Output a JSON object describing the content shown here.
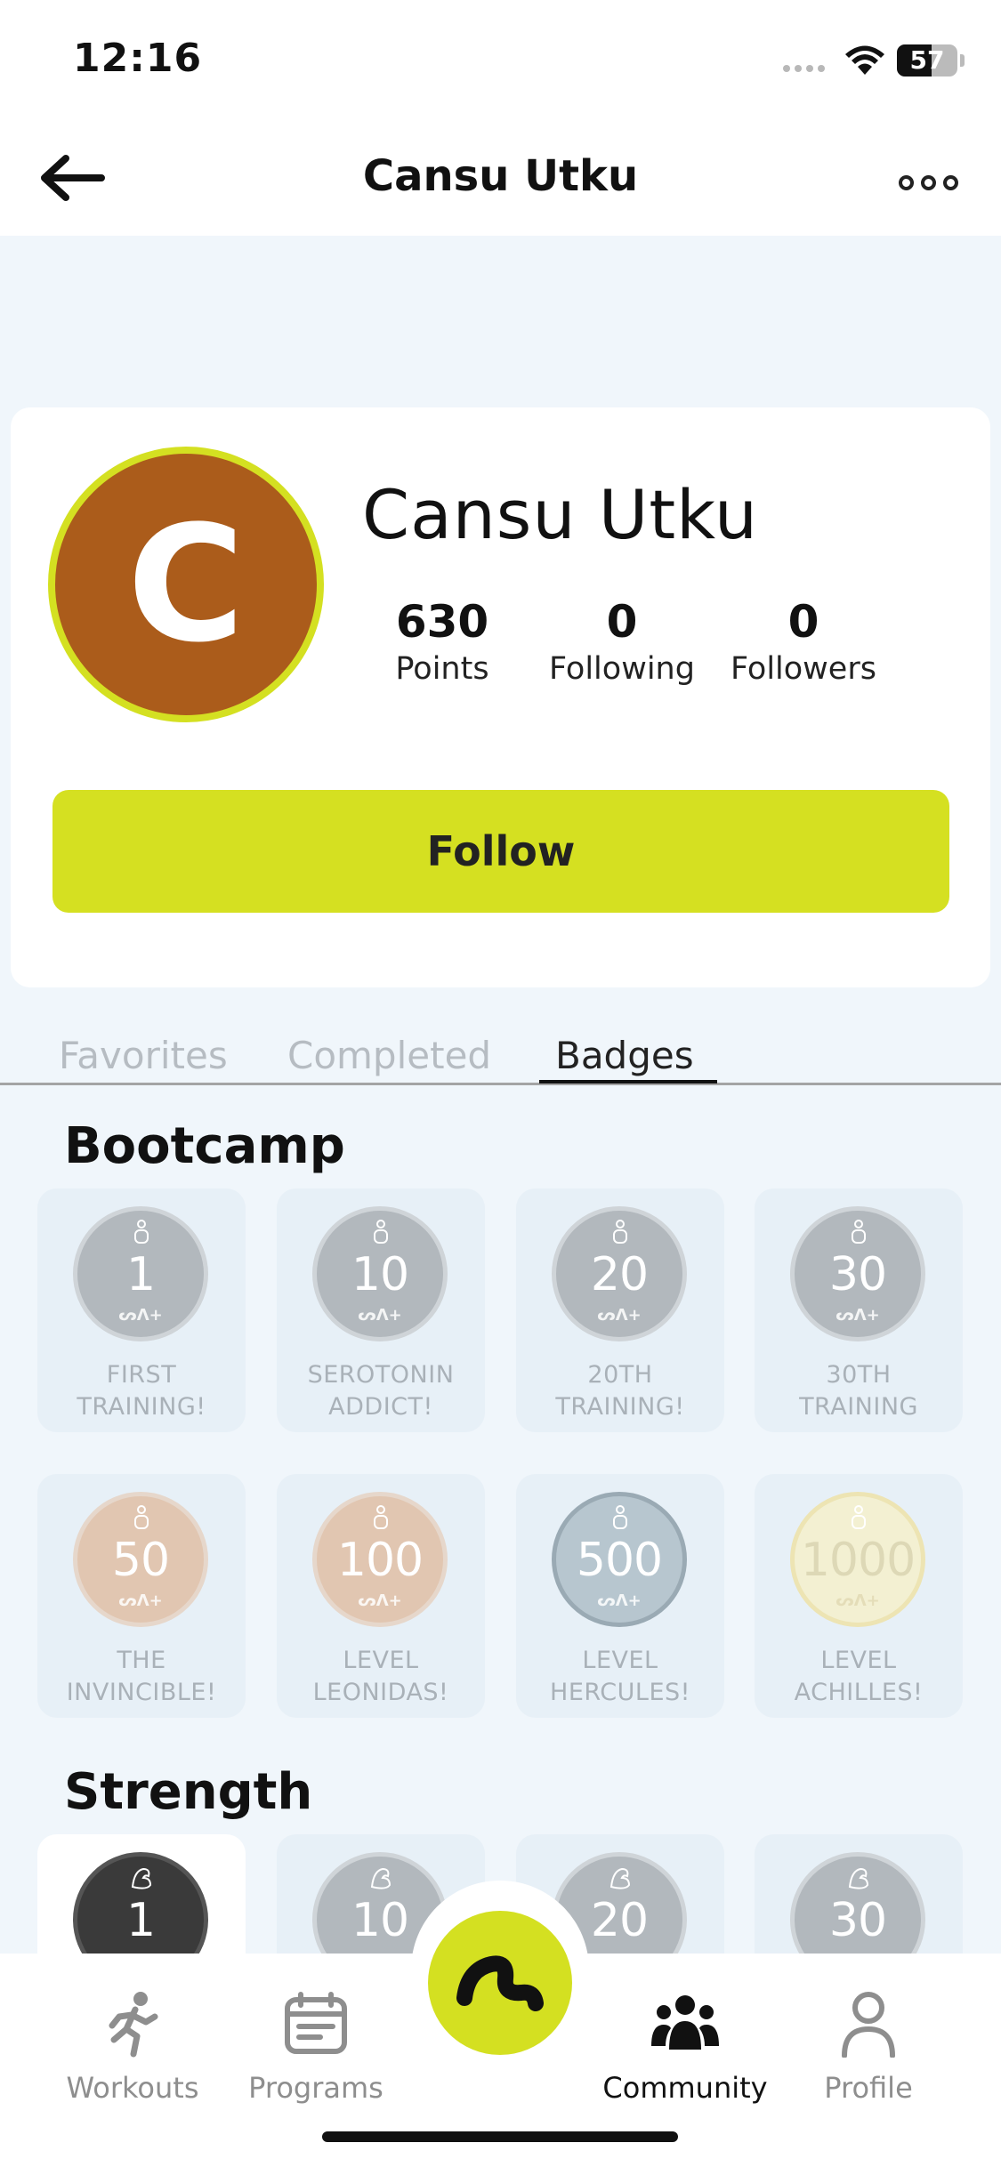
{
  "status": {
    "time": "12:16",
    "battery": "57",
    "battery_level": 0.57
  },
  "header": {
    "title": "Cansu Utku"
  },
  "profile": {
    "initial": "C",
    "name": "Cansu Utku",
    "avatar_color": "#ab5c1b",
    "stats": [
      {
        "value": "630",
        "label": "Points"
      },
      {
        "value": "0",
        "label": "Following"
      },
      {
        "value": "0",
        "label": "Followers"
      }
    ],
    "follow_label": "Follow"
  },
  "tabs": [
    {
      "label": "Favorites",
      "active": false
    },
    {
      "label": "Completed",
      "active": false
    },
    {
      "label": "Badges",
      "active": true
    }
  ],
  "sections": [
    {
      "title": "Bootcamp",
      "badges": [
        {
          "number": "1",
          "label_line1": "FIRST",
          "label_line2": "TRAINING!",
          "tier": "grey"
        },
        {
          "number": "10",
          "label_line1": "SEROTONIN",
          "label_line2": "ADDICT!",
          "tier": "grey"
        },
        {
          "number": "20",
          "label_line1": "20TH",
          "label_line2": "TRAINING!",
          "tier": "grey"
        },
        {
          "number": "30",
          "label_line1": "30TH",
          "label_line2": "TRAINING",
          "tier": "grey"
        },
        {
          "number": "50",
          "label_line1": "THE",
          "label_line2": "INVINCIBLE!",
          "tier": "bronze"
        },
        {
          "number": "100",
          "label_line1": "LEVEL",
          "label_line2": "LEONIDAS!",
          "tier": "bronze"
        },
        {
          "number": "500",
          "label_line1": "LEVEL",
          "label_line2": "HERCULES!",
          "tier": "silver"
        },
        {
          "number": "1000",
          "label_line1": "LEVEL",
          "label_line2": "ACHILLES!",
          "tier": "gold"
        }
      ]
    },
    {
      "title": "Strength",
      "badges": [
        {
          "number": "1",
          "tier": "dark",
          "unlocked": true
        },
        {
          "number": "10",
          "tier": "grey"
        },
        {
          "number": "20",
          "tier": "grey"
        },
        {
          "number": "30",
          "tier": "grey"
        }
      ]
    }
  ],
  "medal_logo": "ᔕᐱ+",
  "bottom_nav": [
    {
      "label": "Workouts",
      "icon": "running-person-icon"
    },
    {
      "label": "Programs",
      "icon": "calendar-icon"
    },
    {
      "label": "Community",
      "icon": "people-group-icon",
      "active": true
    },
    {
      "label": "Profile",
      "icon": "person-icon"
    }
  ],
  "colors": {
    "accent": "#d4e021",
    "background": "#f0f6fb",
    "medal_grey": "#b2b8bd"
  }
}
